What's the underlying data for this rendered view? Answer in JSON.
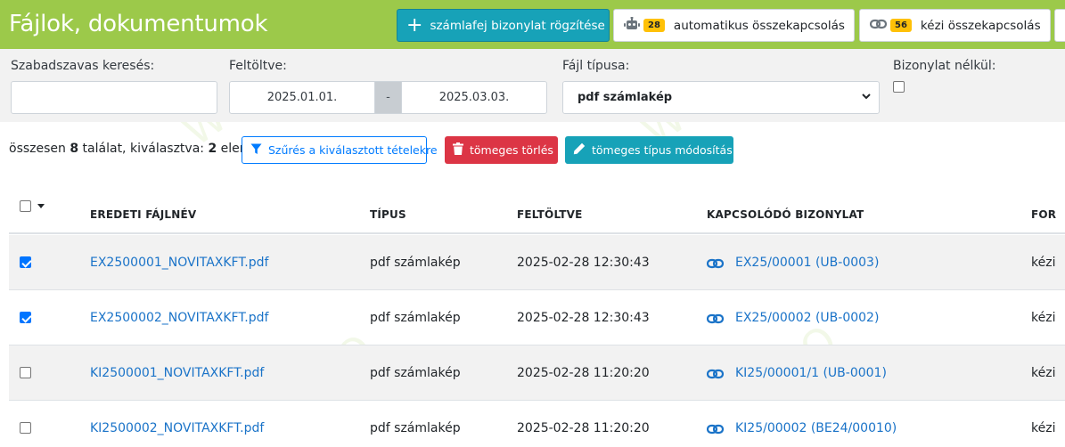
{
  "header": {
    "title": "Fájlok, dokumentumok",
    "add_button": "számlafej bizonylat rögzítése",
    "auto_button": "automatikus összekapcsolás",
    "auto_count": "28",
    "manual_button": "kézi összekapcsolás",
    "manual_count": "56"
  },
  "filters": {
    "search_label": "Szabadszavas keresés:",
    "search_value": "",
    "uploaded_label": "Feltöltve:",
    "date_from": "2025.01.01.",
    "date_sep": "-",
    "date_to": "2025.03.03.",
    "type_label": "Fájl típusa:",
    "type_value": "pdf számlakép",
    "no_doc_label": "Bizonylat nélkül:"
  },
  "summary": {
    "prefix": "összesen ",
    "total": "8",
    "mid": " találat, kiválasztva: ",
    "selected": "2",
    "suffix": " elem"
  },
  "actions": {
    "filter_selected": "Szűrés a kiválasztott tételekre",
    "bulk_delete": "tömeges törlés",
    "bulk_modify": "tömeges típus módosítás"
  },
  "table": {
    "columns": [
      "EREDETI FÁJLNÉV",
      "TÍPUS",
      "FELTÖLTVE",
      "KAPCSOLÓDÓ BIZONYLAT",
      "FOR"
    ],
    "rows": [
      {
        "filename": "EX2500001_NOVITAXKFT.pdf",
        "type": "pdf számlakép",
        "uploaded": "2025-02-28 12:30:43",
        "doc": "EX25/00001 (UB-0003)",
        "source": "kézi"
      },
      {
        "filename": "EX2500002_NOVITAXKFT.pdf",
        "type": "pdf számlakép",
        "uploaded": "2025-02-28 12:30:43",
        "doc": "EX25/00002 (UB-0002)",
        "source": "kézi"
      },
      {
        "filename": "KI2500001_NOVITAXKFT.pdf",
        "type": "pdf számlakép",
        "uploaded": "2025-02-28 11:20:20",
        "doc": "KI25/00001/1 (UB-0001)",
        "source": "kézi"
      },
      {
        "filename": "KI2500002_NOVITAXKFT.pdf",
        "type": "pdf számlakép",
        "uploaded": "2025-02-28 11:20:20",
        "doc": "KI25/00002 (BE24/00010)",
        "source": "kézi"
      }
    ]
  },
  "icons": {
    "add": "plus-icon",
    "auto": "robot-icon",
    "manual": "link-icon",
    "filter": "funnel-icon",
    "delete": "trash-icon",
    "modify": "pencil-icon"
  },
  "colors": {
    "header_bg": "#9cc94a",
    "info": "#17a2b8",
    "danger": "#dc3545",
    "primary": "#007bff",
    "badge": "#ffc107",
    "link": "#1a73c8"
  }
}
